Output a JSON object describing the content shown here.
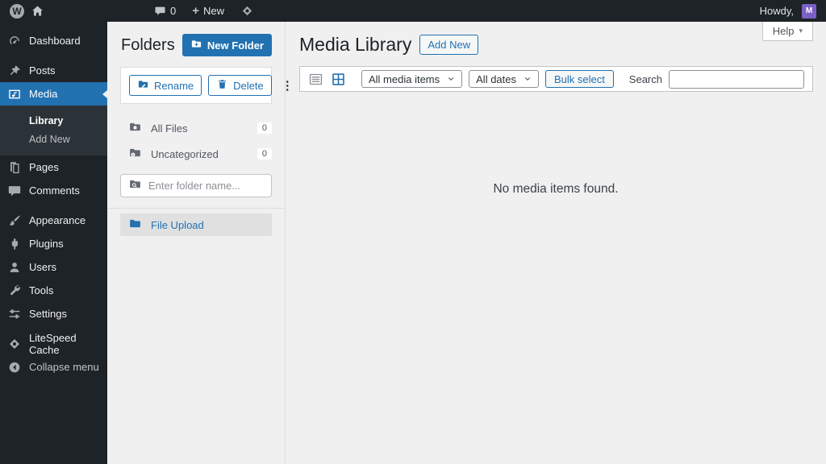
{
  "colors": {
    "accent": "#2271b1",
    "admin_bar_bg": "#1d2327",
    "content_bg": "#f0f0f1",
    "selected_folder_bg": "#e0e0e0",
    "avatar_bg": "#7b5fc7"
  },
  "icons": {
    "wp_logo_letter": "W",
    "plus": "+",
    "ellipsis_vertical": "⋮",
    "caret_down": "▾"
  },
  "admin_bar": {
    "comments_count": "0",
    "new_label": "New",
    "howdy_label": "Howdy,",
    "avatar_letter": "M"
  },
  "sidebar": {
    "items": [
      {
        "label": "Dashboard"
      },
      {
        "label": "Posts"
      },
      {
        "label": "Media"
      },
      {
        "label": "Pages"
      },
      {
        "label": "Comments"
      },
      {
        "label": "Appearance"
      },
      {
        "label": "Plugins"
      },
      {
        "label": "Users"
      },
      {
        "label": "Tools"
      },
      {
        "label": "Settings"
      },
      {
        "label": "LiteSpeed Cache"
      },
      {
        "label": "Collapse menu"
      }
    ],
    "media_submenu": [
      {
        "label": "Library"
      },
      {
        "label": "Add New"
      }
    ]
  },
  "folders": {
    "title": "Folders",
    "new_folder_button": "New Folder",
    "rename_button": "Rename",
    "delete_button": "Delete",
    "items": [
      {
        "label": "All Files",
        "count": "0"
      },
      {
        "label": "Uncategorized",
        "count": "0"
      }
    ],
    "search_placeholder": "Enter folder name...",
    "selected_item": {
      "label": "File Upload"
    }
  },
  "main": {
    "page_title": "Media Library",
    "add_new_button": "Add New",
    "help_button": "Help",
    "media_filter_value": "All media items",
    "date_filter_value": "All dates",
    "bulk_select_button": "Bulk select",
    "search_label": "Search",
    "search_value": "",
    "empty_message": "No media items found."
  }
}
